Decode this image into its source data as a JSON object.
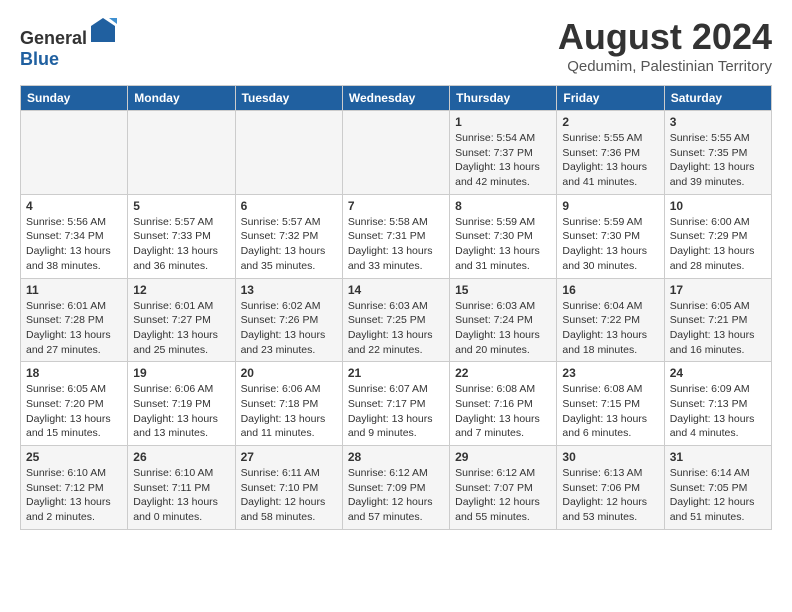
{
  "header": {
    "logo_general": "General",
    "logo_blue": "Blue",
    "main_title": "August 2024",
    "subtitle": "Qedumim, Palestinian Territory"
  },
  "calendar": {
    "weekdays": [
      "Sunday",
      "Monday",
      "Tuesday",
      "Wednesday",
      "Thursday",
      "Friday",
      "Saturday"
    ],
    "weeks": [
      [
        {
          "day": "",
          "info": ""
        },
        {
          "day": "",
          "info": ""
        },
        {
          "day": "",
          "info": ""
        },
        {
          "day": "",
          "info": ""
        },
        {
          "day": "1",
          "info": "Sunrise: 5:54 AM\nSunset: 7:37 PM\nDaylight: 13 hours\nand 42 minutes."
        },
        {
          "day": "2",
          "info": "Sunrise: 5:55 AM\nSunset: 7:36 PM\nDaylight: 13 hours\nand 41 minutes."
        },
        {
          "day": "3",
          "info": "Sunrise: 5:55 AM\nSunset: 7:35 PM\nDaylight: 13 hours\nand 39 minutes."
        }
      ],
      [
        {
          "day": "4",
          "info": "Sunrise: 5:56 AM\nSunset: 7:34 PM\nDaylight: 13 hours\nand 38 minutes."
        },
        {
          "day": "5",
          "info": "Sunrise: 5:57 AM\nSunset: 7:33 PM\nDaylight: 13 hours\nand 36 minutes."
        },
        {
          "day": "6",
          "info": "Sunrise: 5:57 AM\nSunset: 7:32 PM\nDaylight: 13 hours\nand 35 minutes."
        },
        {
          "day": "7",
          "info": "Sunrise: 5:58 AM\nSunset: 7:31 PM\nDaylight: 13 hours\nand 33 minutes."
        },
        {
          "day": "8",
          "info": "Sunrise: 5:59 AM\nSunset: 7:30 PM\nDaylight: 13 hours\nand 31 minutes."
        },
        {
          "day": "9",
          "info": "Sunrise: 5:59 AM\nSunset: 7:30 PM\nDaylight: 13 hours\nand 30 minutes."
        },
        {
          "day": "10",
          "info": "Sunrise: 6:00 AM\nSunset: 7:29 PM\nDaylight: 13 hours\nand 28 minutes."
        }
      ],
      [
        {
          "day": "11",
          "info": "Sunrise: 6:01 AM\nSunset: 7:28 PM\nDaylight: 13 hours\nand 27 minutes."
        },
        {
          "day": "12",
          "info": "Sunrise: 6:01 AM\nSunset: 7:27 PM\nDaylight: 13 hours\nand 25 minutes."
        },
        {
          "day": "13",
          "info": "Sunrise: 6:02 AM\nSunset: 7:26 PM\nDaylight: 13 hours\nand 23 minutes."
        },
        {
          "day": "14",
          "info": "Sunrise: 6:03 AM\nSunset: 7:25 PM\nDaylight: 13 hours\nand 22 minutes."
        },
        {
          "day": "15",
          "info": "Sunrise: 6:03 AM\nSunset: 7:24 PM\nDaylight: 13 hours\nand 20 minutes."
        },
        {
          "day": "16",
          "info": "Sunrise: 6:04 AM\nSunset: 7:22 PM\nDaylight: 13 hours\nand 18 minutes."
        },
        {
          "day": "17",
          "info": "Sunrise: 6:05 AM\nSunset: 7:21 PM\nDaylight: 13 hours\nand 16 minutes."
        }
      ],
      [
        {
          "day": "18",
          "info": "Sunrise: 6:05 AM\nSunset: 7:20 PM\nDaylight: 13 hours\nand 15 minutes."
        },
        {
          "day": "19",
          "info": "Sunrise: 6:06 AM\nSunset: 7:19 PM\nDaylight: 13 hours\nand 13 minutes."
        },
        {
          "day": "20",
          "info": "Sunrise: 6:06 AM\nSunset: 7:18 PM\nDaylight: 13 hours\nand 11 minutes."
        },
        {
          "day": "21",
          "info": "Sunrise: 6:07 AM\nSunset: 7:17 PM\nDaylight: 13 hours\nand 9 minutes."
        },
        {
          "day": "22",
          "info": "Sunrise: 6:08 AM\nSunset: 7:16 PM\nDaylight: 13 hours\nand 7 minutes."
        },
        {
          "day": "23",
          "info": "Sunrise: 6:08 AM\nSunset: 7:15 PM\nDaylight: 13 hours\nand 6 minutes."
        },
        {
          "day": "24",
          "info": "Sunrise: 6:09 AM\nSunset: 7:13 PM\nDaylight: 13 hours\nand 4 minutes."
        }
      ],
      [
        {
          "day": "25",
          "info": "Sunrise: 6:10 AM\nSunset: 7:12 PM\nDaylight: 13 hours\nand 2 minutes."
        },
        {
          "day": "26",
          "info": "Sunrise: 6:10 AM\nSunset: 7:11 PM\nDaylight: 13 hours\nand 0 minutes."
        },
        {
          "day": "27",
          "info": "Sunrise: 6:11 AM\nSunset: 7:10 PM\nDaylight: 12 hours\nand 58 minutes."
        },
        {
          "day": "28",
          "info": "Sunrise: 6:12 AM\nSunset: 7:09 PM\nDaylight: 12 hours\nand 57 minutes."
        },
        {
          "day": "29",
          "info": "Sunrise: 6:12 AM\nSunset: 7:07 PM\nDaylight: 12 hours\nand 55 minutes."
        },
        {
          "day": "30",
          "info": "Sunrise: 6:13 AM\nSunset: 7:06 PM\nDaylight: 12 hours\nand 53 minutes."
        },
        {
          "day": "31",
          "info": "Sunrise: 6:14 AM\nSunset: 7:05 PM\nDaylight: 12 hours\nand 51 minutes."
        }
      ]
    ]
  }
}
